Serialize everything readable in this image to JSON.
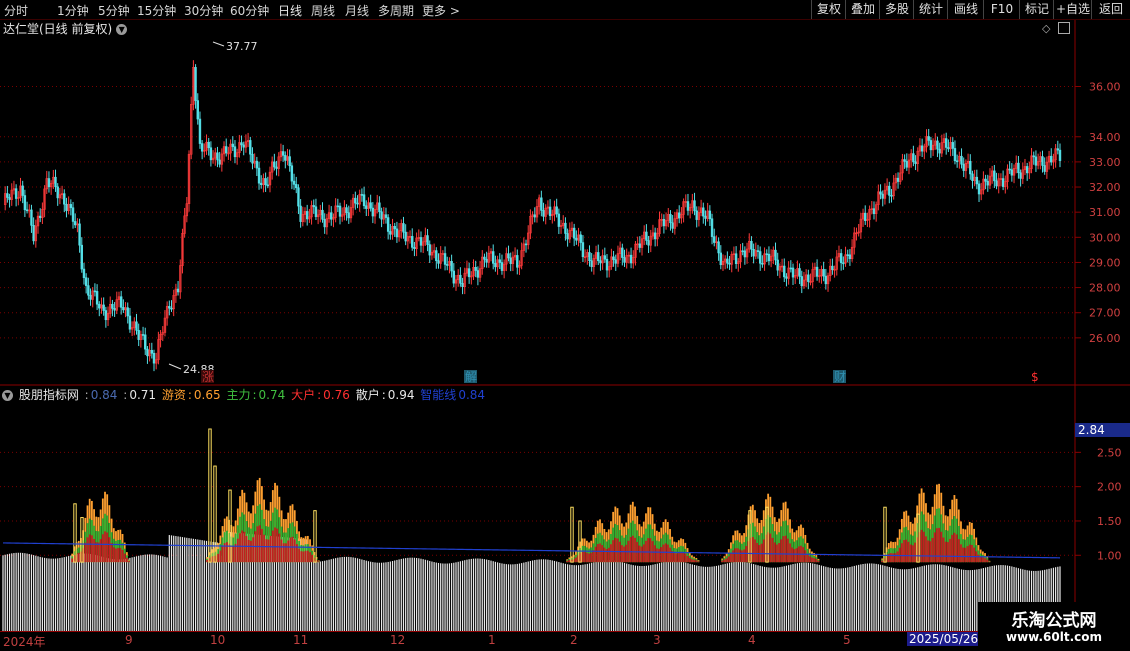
{
  "periods": [
    "分时",
    "1分钟",
    "5分钟",
    "15分钟",
    "30分钟",
    "60分钟",
    "日线",
    "周线",
    "月线",
    "多周期",
    "更多 >"
  ],
  "active_period": "日线",
  "toolbar": [
    "复权",
    "叠加",
    "多股",
    "统计",
    "画线",
    "F10",
    "标记",
    "+自选",
    "返回"
  ],
  "title": "达仁堂(日线 前复权)",
  "main_axis": [
    "36.00",
    "34.00",
    "33.00",
    "32.00",
    "31.00",
    "30.00",
    "29.00",
    "28.00",
    "27.00",
    "26.00"
  ],
  "high_label": "37.77",
  "low_label": "24.88",
  "event_tags": [
    {
      "text": "涨",
      "color": "#c03030"
    },
    {
      "text": "解",
      "color": "#2f8fb0"
    },
    {
      "text": "财",
      "color": "#2f8fb0"
    },
    {
      "text": "$",
      "color": "#ff3030"
    }
  ],
  "indicator": {
    "name": "股朋指标网",
    "v0": "0.84",
    "v1": "0.71",
    "items": [
      {
        "label": "游资",
        "value": "0.65",
        "color": "#ffa030"
      },
      {
        "label": "主力",
        "value": "0.74",
        "color": "#40c040"
      },
      {
        "label": "大户",
        "value": "0.76",
        "color": "#ff3030"
      },
      {
        "label": "散户",
        "value": "0.94",
        "color": "#e8e8e8"
      },
      {
        "label": "智能线",
        "value": "0.84",
        "color": "#2040d0"
      }
    ]
  },
  "sub_axis": [
    "2.50",
    "2.00",
    "1.50",
    "1.00"
  ],
  "sub_price_badge": "2.84",
  "x_labels": [
    "2024年",
    "9",
    "10",
    "11",
    "12",
    "1",
    "2",
    "3",
    "4",
    "5"
  ],
  "highlight_date": "2025/05/26/-",
  "watermark": {
    "line1": "乐淘公式网",
    "line2": "www.60lt.com"
  },
  "colors": {
    "up": "#ff3b3b",
    "down": "#54e0e8",
    "grid": "#7a0000",
    "axis": "#8b0000"
  }
}
